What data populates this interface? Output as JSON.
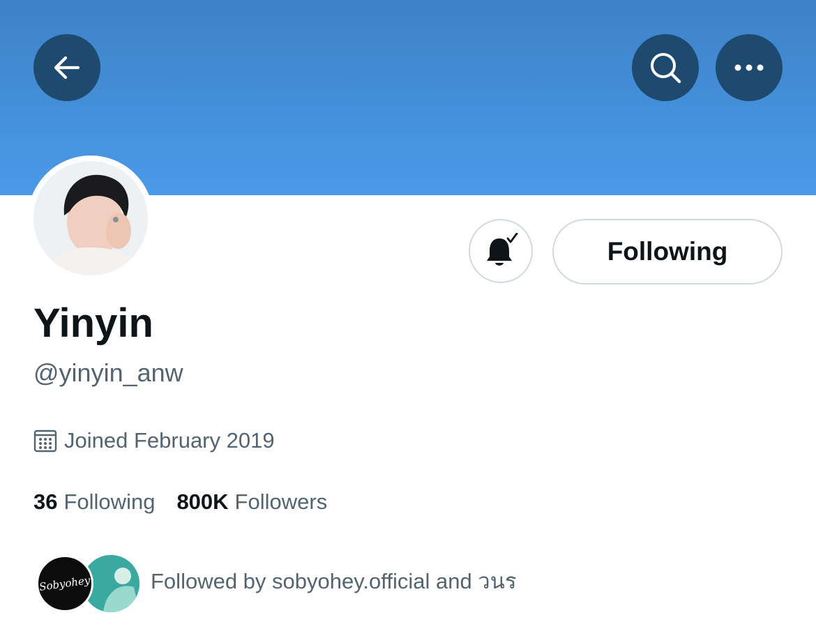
{
  "header": {
    "back_icon": "arrow-left-icon",
    "search_icon": "search-icon",
    "more_icon": "more-horizontal-icon",
    "banner_color": "#4a9ae8",
    "button_color": "#1f4a70"
  },
  "profile": {
    "display_name": "Yinyin",
    "handle": "@yinyin_anw",
    "joined": "Joined February 2019",
    "joined_icon": "calendar-icon",
    "notification_icon": "bell-check-icon",
    "follow_button_label": "Following"
  },
  "stats": {
    "following_count": "36",
    "following_label": "Following",
    "followers_count": "800K",
    "followers_label": "Followers"
  },
  "followed_by": {
    "text": "Followed by sobyohey.official and วนร",
    "avatar_1_logo": "Sobyohey"
  }
}
